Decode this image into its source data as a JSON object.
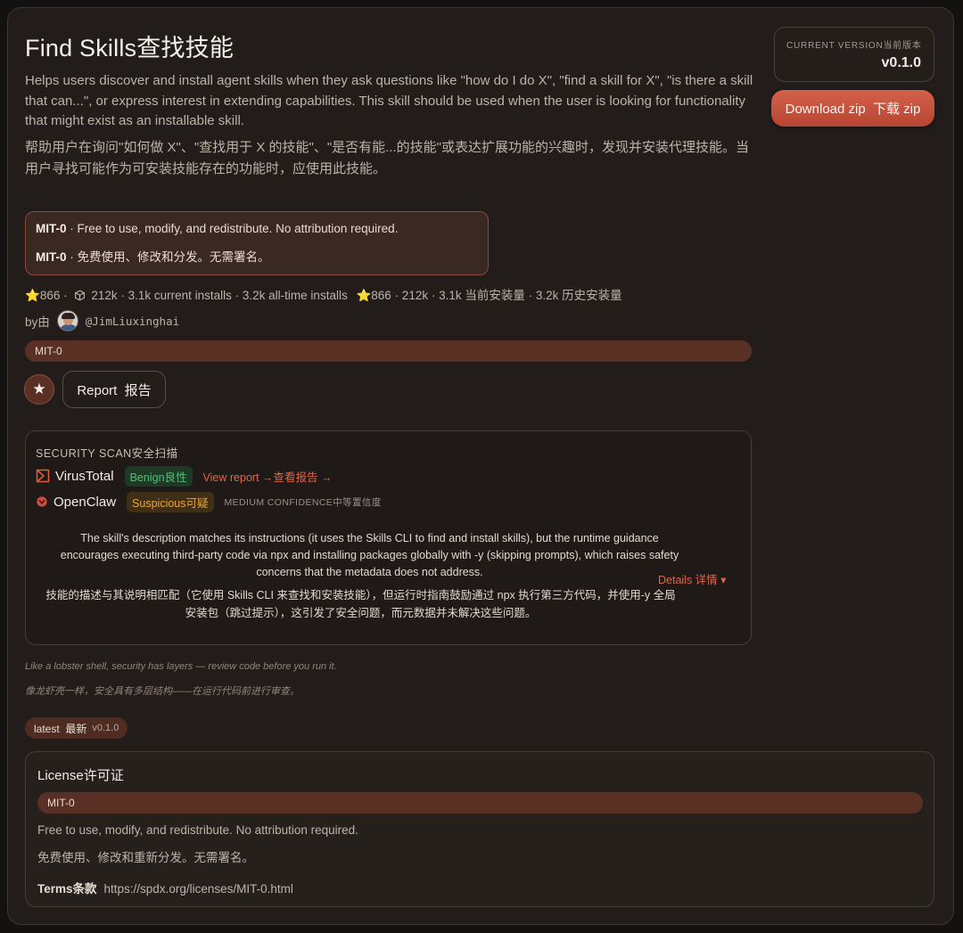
{
  "header": {
    "title": "Find Skills查找技能",
    "description_en": "Helps users discover and install agent skills when they ask questions like \"how do I do X\", \"find a skill for X\", \"is there a skill that can...\", or express interest in extending capabilities. This skill should be used when the user is looking for functionality that might exist as an installable skill.",
    "description_zh": "帮助用户在询问\"如何做 X\"、\"查找用于 X 的技能\"、\"是否有能...的技能\"或表达扩展功能的兴趣时，发现并安装代理技能。当用户寻找可能作为可安装技能存在的功能时，应使用此技能。"
  },
  "version_box": {
    "label": "CURRENT VERSION当前版本",
    "value": "v0.1.0"
  },
  "download": {
    "label": "Download zip  下载 zip"
  },
  "license_note": {
    "name": "MIT-0",
    "en": " · Free to use, modify, and redistribute. No attribution required.",
    "zh": " · 免费使用、修改和分发。无需署名。"
  },
  "stats": {
    "stars": "866",
    "sep1": " · ",
    "downloads_text": "212k · 3.1k current installs · 3.2k all-time installs",
    "stars_zh": "866",
    "zh_text": " · 212k · 3.1k 当前安装量 · 3.2k 历史安装量"
  },
  "author": {
    "by_label": "by由",
    "handle": "@JimLiuxinghai"
  },
  "license_pill": "MIT-0",
  "actions": {
    "star_glyph": "★",
    "report_label": "Report  报告"
  },
  "security_scan": {
    "title": "SECURITY SCAN安全扫描",
    "virustotal": {
      "name": "VirusTotal",
      "verdict": "Benign良性",
      "link": "View report →查看报告 →"
    },
    "openclaw": {
      "name": "OpenClaw",
      "verdict": "Suspicious可疑",
      "confidence": "MEDIUM CONFIDENCE中等置信度"
    },
    "summary_en": "The skill's description matches its instructions (it uses the Skills CLI to find and install skills), but the runtime guidance encourages executing third-party code via npx and installing packages globally with -y (skipping prompts), which raises safety concerns that the metadata does not address.",
    "summary_zh": "技能的描述与其说明相匹配（它使用 Skills CLI 来查找和安装技能），但运行时指南鼓励通过 npx 执行第三方代码，并使用-y 全局安装包（跳过提示），这引发了安全问题，而元数据并未解决这些问题。",
    "details_link": "Details 详情 ▾"
  },
  "tagline": {
    "en": "Like a lobster shell, security has layers — review code before you run it.",
    "zh": "像龙虾壳一样，安全具有多层结构——在运行代码前进行审查。"
  },
  "version_tag": {
    "label": "latest  最新",
    "version": "v0.1.0"
  },
  "license_card": {
    "title": "License许可证",
    "pill": "MIT-0",
    "en": "Free to use, modify, and redistribute. No attribution required.",
    "zh": "免费使用、修改和重新分发。无需署名。",
    "terms_label": "Terms条款",
    "terms_url": "https://spdx.org/licenses/MIT-0.html"
  },
  "colors": {
    "accent": "#c9503a",
    "benign": "#4cc36b",
    "suspicious": "#e9a636",
    "background": "#221d1a"
  }
}
